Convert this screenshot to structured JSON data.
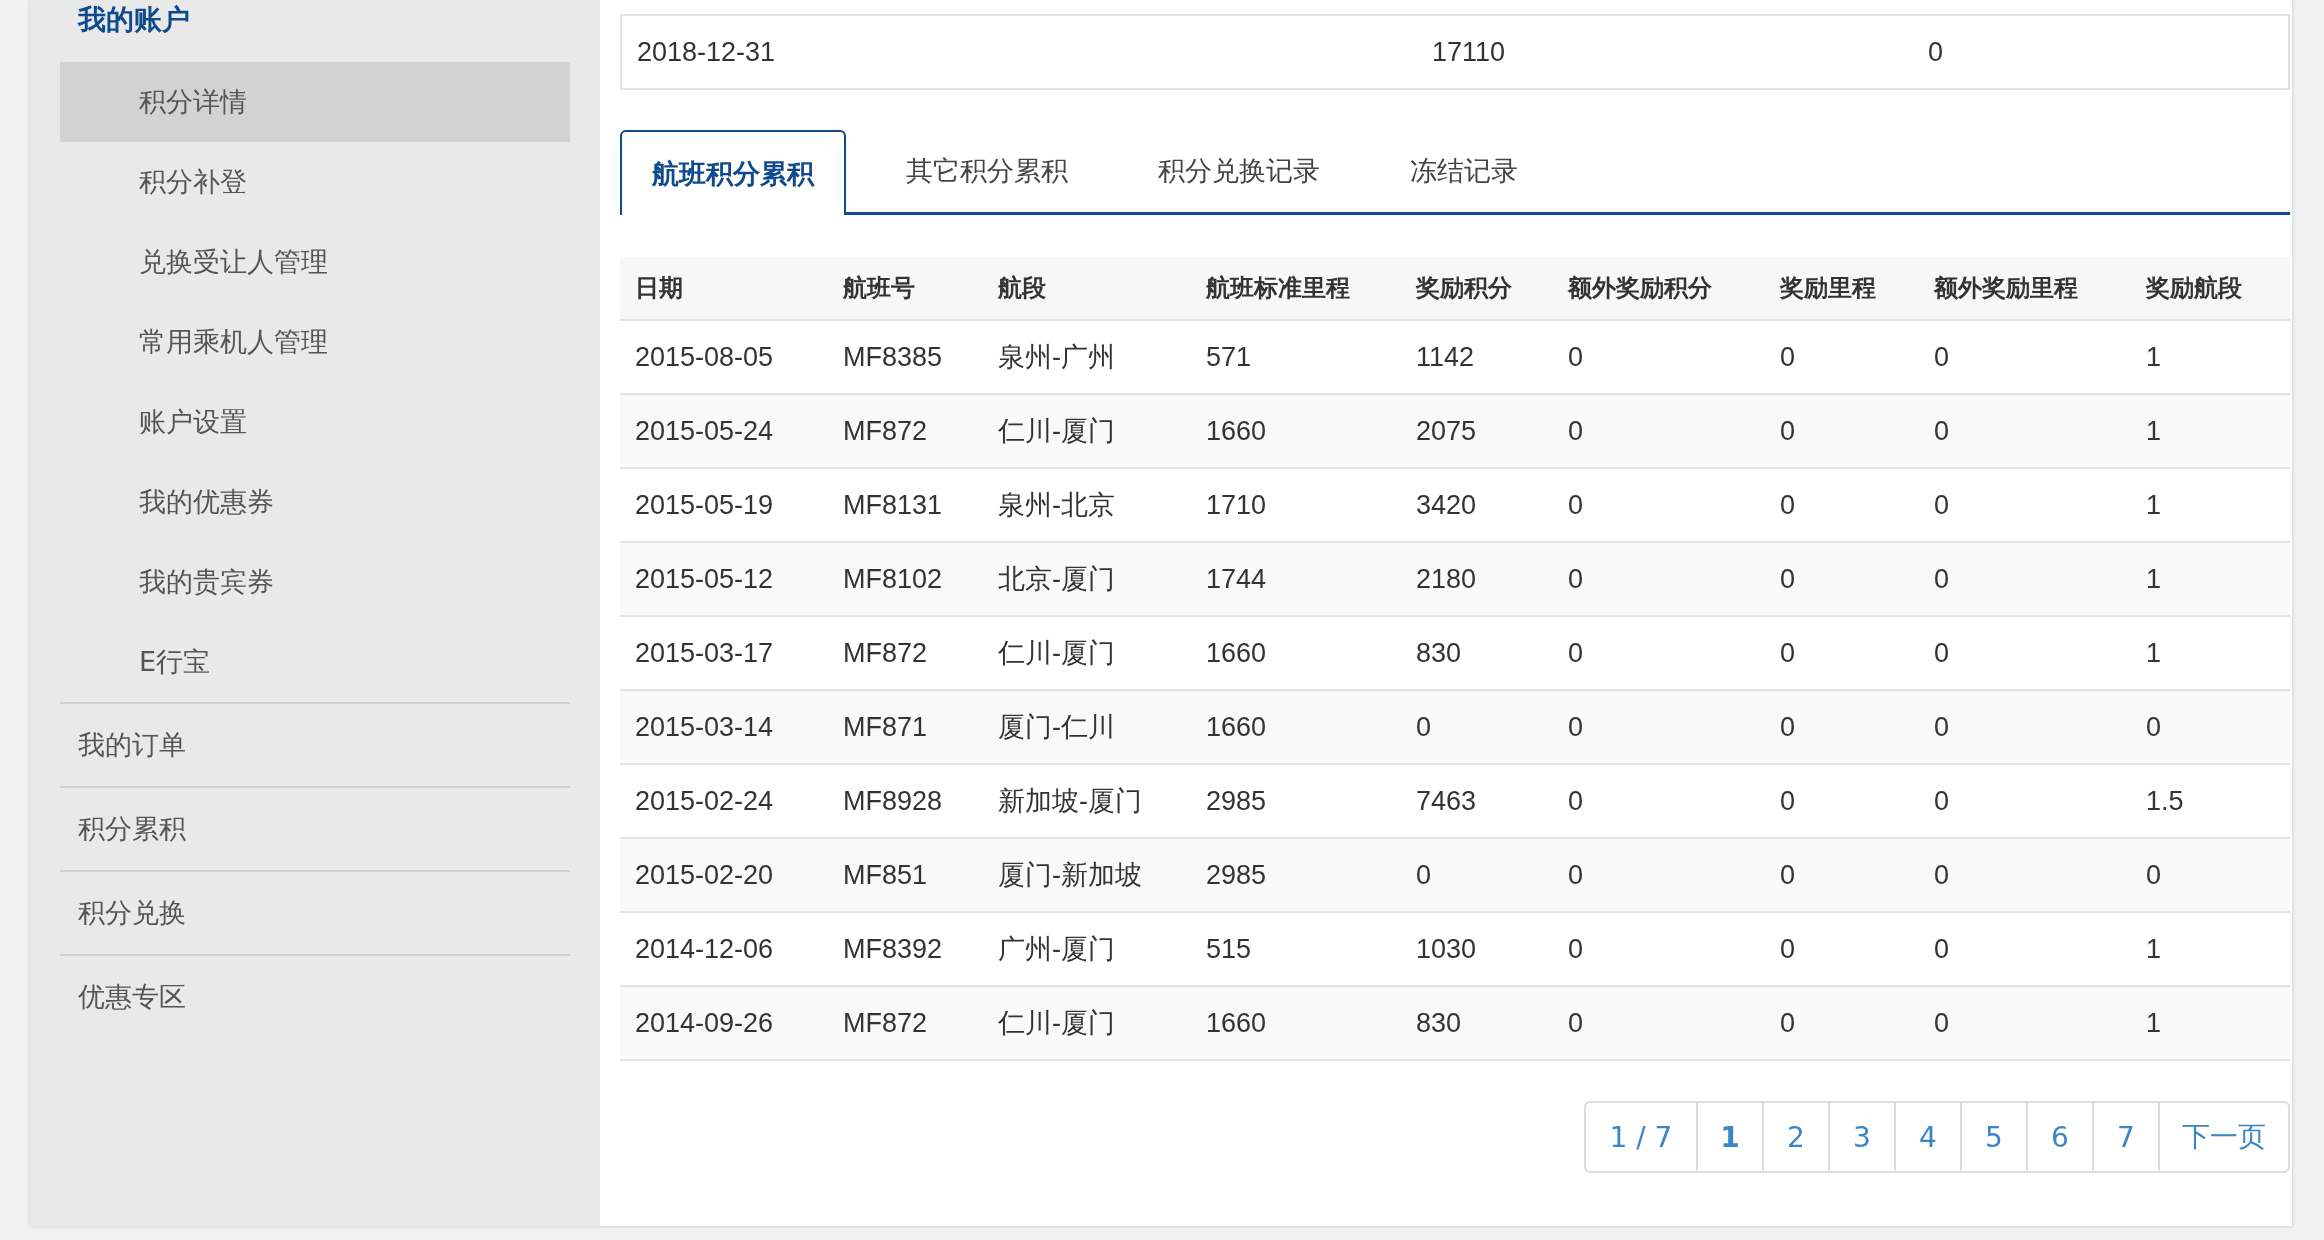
{
  "sidebar": {
    "section_title": "我的账户",
    "sub_items": [
      {
        "label": "积分详情",
        "selected": true
      },
      {
        "label": "积分补登",
        "selected": false
      },
      {
        "label": "兑换受让人管理",
        "selected": false
      },
      {
        "label": "常用乘机人管理",
        "selected": false
      },
      {
        "label": "账户设置",
        "selected": false
      },
      {
        "label": "我的优惠券",
        "selected": false
      },
      {
        "label": "我的贵宾券",
        "selected": false
      },
      {
        "label": "E行宝",
        "selected": false
      }
    ],
    "items": [
      "我的订单",
      "积分累积",
      "积分兑换",
      "优惠专区"
    ]
  },
  "summary_row": [
    "2018-12-31",
    "17110",
    "0"
  ],
  "tabs": [
    {
      "label": "航班积分累积",
      "selected": true
    },
    {
      "label": "其它积分累积",
      "selected": false
    },
    {
      "label": "积分兑换记录",
      "selected": false
    },
    {
      "label": "冻结记录",
      "selected": false
    }
  ],
  "table": {
    "columns": [
      "日期",
      "航班号",
      "航段",
      "航班标准里程",
      "奖励积分",
      "额外奖励积分",
      "奖励里程",
      "额外奖励里程",
      "奖励航段"
    ],
    "rows": [
      [
        "2015-08-05",
        "MF8385",
        "泉州-广州",
        "571",
        "1142",
        "0",
        "0",
        "0",
        "1"
      ],
      [
        "2015-05-24",
        "MF872",
        "仁川-厦门",
        "1660",
        "2075",
        "0",
        "0",
        "0",
        "1"
      ],
      [
        "2015-05-19",
        "MF8131",
        "泉州-北京",
        "1710",
        "3420",
        "0",
        "0",
        "0",
        "1"
      ],
      [
        "2015-05-12",
        "MF8102",
        "北京-厦门",
        "1744",
        "2180",
        "0",
        "0",
        "0",
        "1"
      ],
      [
        "2015-03-17",
        "MF872",
        "仁川-厦门",
        "1660",
        "830",
        "0",
        "0",
        "0",
        "1"
      ],
      [
        "2015-03-14",
        "MF871",
        "厦门-仁川",
        "1660",
        "0",
        "0",
        "0",
        "0",
        "0"
      ],
      [
        "2015-02-24",
        "MF8928",
        "新加坡-厦门",
        "2985",
        "7463",
        "0",
        "0",
        "0",
        "1.5"
      ],
      [
        "2015-02-20",
        "MF851",
        "厦门-新加坡",
        "2985",
        "0",
        "0",
        "0",
        "0",
        "0"
      ],
      [
        "2014-12-06",
        "MF8392",
        "广州-厦门",
        "515",
        "1030",
        "0",
        "0",
        "0",
        "1"
      ],
      [
        "2014-09-26",
        "MF872",
        "仁川-厦门",
        "1660",
        "830",
        "0",
        "0",
        "0",
        "1"
      ]
    ]
  },
  "pagination": {
    "page_info": "1 / 7",
    "pages": [
      {
        "label": "1",
        "selected": true
      },
      {
        "label": "2",
        "selected": false
      },
      {
        "label": "3",
        "selected": false
      },
      {
        "label": "4",
        "selected": false
      },
      {
        "label": "5",
        "selected": false
      },
      {
        "label": "6",
        "selected": false
      },
      {
        "label": "7",
        "selected": false
      }
    ],
    "next": "下一页"
  }
}
